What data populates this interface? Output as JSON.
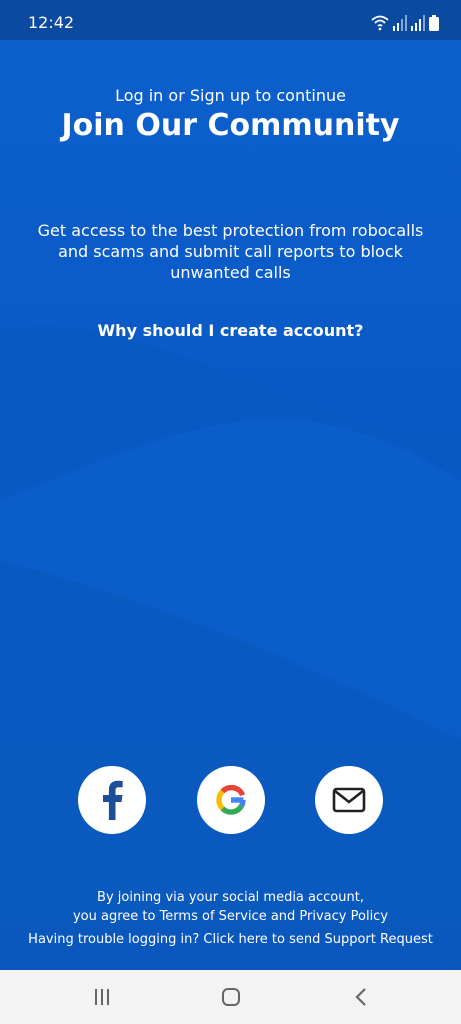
{
  "status_bar": {
    "time": "12:42",
    "icons": [
      "wifi-icon",
      "signal-icon",
      "signal-icon",
      "battery-icon"
    ]
  },
  "header": {
    "subtitle": "Log in or Sign up to continue",
    "title": "Join Our Community"
  },
  "description": "Get access to the best protection from robocalls and scams and submit call reports to block unwanted calls",
  "why_link": "Why should I create account?",
  "social_buttons": [
    {
      "name": "facebook",
      "icon": "facebook-icon"
    },
    {
      "name": "google",
      "icon": "google-icon"
    },
    {
      "name": "email",
      "icon": "mail-icon"
    }
  ],
  "legal": {
    "line1": "By joining via your social media account,",
    "line2": "you agree to Terms of Service and Privacy Policy"
  },
  "support_link": "Having trouble logging in? Click here to send Support Request",
  "nav_bar": {
    "buttons": [
      "recents-icon",
      "home-icon",
      "back-icon"
    ]
  },
  "colors": {
    "background": "#0a5bc4",
    "status_bar": "#0a4aa0",
    "nav_bar": "#f3f3f3",
    "facebook": "#1d4e9a",
    "text": "#ffffff"
  }
}
